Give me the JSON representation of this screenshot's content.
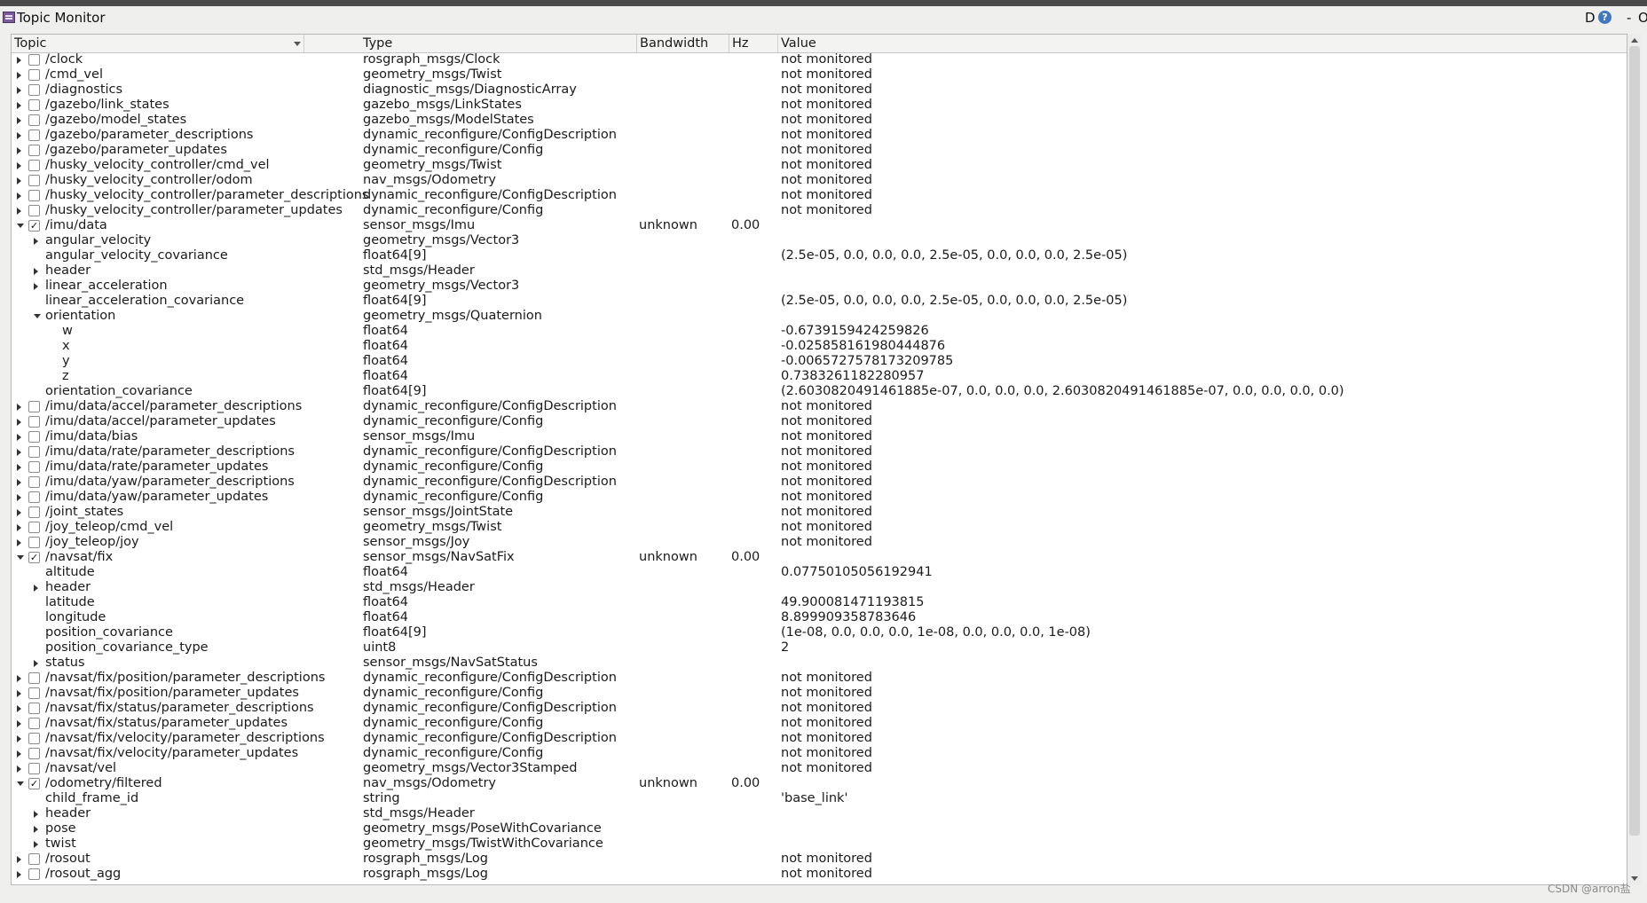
{
  "window": {
    "title": "Topic Monitor",
    "ctrl_d": "D",
    "help": "?",
    "minimize": "-",
    "close": "O"
  },
  "columns": {
    "topic": "Topic",
    "type": "Type",
    "bandwidth": "Bandwidth",
    "hz": "Hz",
    "value": "Value"
  },
  "rows": [
    {
      "level": 0,
      "exp": "c",
      "cb": "u",
      "topic": "/clock",
      "type": "rosgraph_msgs/Clock",
      "bw": "",
      "hz": "",
      "value": "not monitored"
    },
    {
      "level": 0,
      "exp": "c",
      "cb": "u",
      "topic": "/cmd_vel",
      "type": "geometry_msgs/Twist",
      "bw": "",
      "hz": "",
      "value": "not monitored"
    },
    {
      "level": 0,
      "exp": "c",
      "cb": "u",
      "topic": "/diagnostics",
      "type": "diagnostic_msgs/DiagnosticArray",
      "bw": "",
      "hz": "",
      "value": "not monitored"
    },
    {
      "level": 0,
      "exp": "c",
      "cb": "u",
      "topic": "/gazebo/link_states",
      "type": "gazebo_msgs/LinkStates",
      "bw": "",
      "hz": "",
      "value": "not monitored"
    },
    {
      "level": 0,
      "exp": "c",
      "cb": "u",
      "topic": "/gazebo/model_states",
      "type": "gazebo_msgs/ModelStates",
      "bw": "",
      "hz": "",
      "value": "not monitored"
    },
    {
      "level": 0,
      "exp": "c",
      "cb": "u",
      "topic": "/gazebo/parameter_descriptions",
      "type": "dynamic_reconfigure/ConfigDescription",
      "bw": "",
      "hz": "",
      "value": "not monitored"
    },
    {
      "level": 0,
      "exp": "c",
      "cb": "u",
      "topic": "/gazebo/parameter_updates",
      "type": "dynamic_reconfigure/Config",
      "bw": "",
      "hz": "",
      "value": "not monitored"
    },
    {
      "level": 0,
      "exp": "c",
      "cb": "u",
      "topic": "/husky_velocity_controller/cmd_vel",
      "type": "geometry_msgs/Twist",
      "bw": "",
      "hz": "",
      "value": "not monitored"
    },
    {
      "level": 0,
      "exp": "c",
      "cb": "u",
      "topic": "/husky_velocity_controller/odom",
      "type": "nav_msgs/Odometry",
      "bw": "",
      "hz": "",
      "value": "not monitored"
    },
    {
      "level": 0,
      "exp": "c",
      "cb": "u",
      "topic": "/husky_velocity_controller/parameter_descriptions",
      "type": "dynamic_reconfigure/ConfigDescription",
      "bw": "",
      "hz": "",
      "value": "not monitored"
    },
    {
      "level": 0,
      "exp": "c",
      "cb": "u",
      "topic": "/husky_velocity_controller/parameter_updates",
      "type": "dynamic_reconfigure/Config",
      "bw": "",
      "hz": "",
      "value": "not monitored"
    },
    {
      "level": 0,
      "exp": "e",
      "cb": "c",
      "topic": "/imu/data",
      "type": "sensor_msgs/Imu",
      "bw": "unknown",
      "hz": "0.00",
      "value": ""
    },
    {
      "level": 1,
      "exp": "c",
      "cb": "n",
      "topic": "angular_velocity",
      "type": "geometry_msgs/Vector3",
      "bw": "",
      "hz": "",
      "value": ""
    },
    {
      "level": 1,
      "exp": "n",
      "cb": "n",
      "topic": "angular_velocity_covariance",
      "type": "float64[9]",
      "bw": "",
      "hz": "",
      "value": "(2.5e-05, 0.0, 0.0, 0.0, 2.5e-05, 0.0, 0.0, 0.0, 2.5e-05)"
    },
    {
      "level": 1,
      "exp": "c",
      "cb": "n",
      "topic": "header",
      "type": "std_msgs/Header",
      "bw": "",
      "hz": "",
      "value": ""
    },
    {
      "level": 1,
      "exp": "c",
      "cb": "n",
      "topic": "linear_acceleration",
      "type": "geometry_msgs/Vector3",
      "bw": "",
      "hz": "",
      "value": ""
    },
    {
      "level": 1,
      "exp": "n",
      "cb": "n",
      "topic": "linear_acceleration_covariance",
      "type": "float64[9]",
      "bw": "",
      "hz": "",
      "value": "(2.5e-05, 0.0, 0.0, 0.0, 2.5e-05, 0.0, 0.0, 0.0, 2.5e-05)"
    },
    {
      "level": 1,
      "exp": "e",
      "cb": "n",
      "topic": "orientation",
      "type": "geometry_msgs/Quaternion",
      "bw": "",
      "hz": "",
      "value": ""
    },
    {
      "level": 2,
      "exp": "n",
      "cb": "n",
      "topic": "w",
      "type": "float64",
      "bw": "",
      "hz": "",
      "value": "-0.6739159424259826"
    },
    {
      "level": 2,
      "exp": "n",
      "cb": "n",
      "topic": "x",
      "type": "float64",
      "bw": "",
      "hz": "",
      "value": "-0.025858161980444876"
    },
    {
      "level": 2,
      "exp": "n",
      "cb": "n",
      "topic": "y",
      "type": "float64",
      "bw": "",
      "hz": "",
      "value": "-0.0065727578173209785"
    },
    {
      "level": 2,
      "exp": "n",
      "cb": "n",
      "topic": "z",
      "type": "float64",
      "bw": "",
      "hz": "",
      "value": "0.7383261182280957"
    },
    {
      "level": 1,
      "exp": "n",
      "cb": "n",
      "topic": "orientation_covariance",
      "type": "float64[9]",
      "bw": "",
      "hz": "",
      "value": "(2.6030820491461885e-07, 0.0, 0.0, 0.0, 2.6030820491461885e-07, 0.0, 0.0, 0.0, 0.0)"
    },
    {
      "level": 0,
      "exp": "c",
      "cb": "u",
      "topic": "/imu/data/accel/parameter_descriptions",
      "type": "dynamic_reconfigure/ConfigDescription",
      "bw": "",
      "hz": "",
      "value": "not monitored"
    },
    {
      "level": 0,
      "exp": "c",
      "cb": "u",
      "topic": "/imu/data/accel/parameter_updates",
      "type": "dynamic_reconfigure/Config",
      "bw": "",
      "hz": "",
      "value": "not monitored"
    },
    {
      "level": 0,
      "exp": "c",
      "cb": "u",
      "topic": "/imu/data/bias",
      "type": "sensor_msgs/Imu",
      "bw": "",
      "hz": "",
      "value": "not monitored"
    },
    {
      "level": 0,
      "exp": "c",
      "cb": "u",
      "topic": "/imu/data/rate/parameter_descriptions",
      "type": "dynamic_reconfigure/ConfigDescription",
      "bw": "",
      "hz": "",
      "value": "not monitored"
    },
    {
      "level": 0,
      "exp": "c",
      "cb": "u",
      "topic": "/imu/data/rate/parameter_updates",
      "type": "dynamic_reconfigure/Config",
      "bw": "",
      "hz": "",
      "value": "not monitored"
    },
    {
      "level": 0,
      "exp": "c",
      "cb": "u",
      "topic": "/imu/data/yaw/parameter_descriptions",
      "type": "dynamic_reconfigure/ConfigDescription",
      "bw": "",
      "hz": "",
      "value": "not monitored"
    },
    {
      "level": 0,
      "exp": "c",
      "cb": "u",
      "topic": "/imu/data/yaw/parameter_updates",
      "type": "dynamic_reconfigure/Config",
      "bw": "",
      "hz": "",
      "value": "not monitored"
    },
    {
      "level": 0,
      "exp": "c",
      "cb": "u",
      "topic": "/joint_states",
      "type": "sensor_msgs/JointState",
      "bw": "",
      "hz": "",
      "value": "not monitored"
    },
    {
      "level": 0,
      "exp": "c",
      "cb": "u",
      "topic": "/joy_teleop/cmd_vel",
      "type": "geometry_msgs/Twist",
      "bw": "",
      "hz": "",
      "value": "not monitored"
    },
    {
      "level": 0,
      "exp": "c",
      "cb": "u",
      "topic": "/joy_teleop/joy",
      "type": "sensor_msgs/Joy",
      "bw": "",
      "hz": "",
      "value": "not monitored"
    },
    {
      "level": 0,
      "exp": "e",
      "cb": "c",
      "topic": "/navsat/fix",
      "type": "sensor_msgs/NavSatFix",
      "bw": "unknown",
      "hz": "0.00",
      "value": ""
    },
    {
      "level": 1,
      "exp": "n",
      "cb": "n",
      "topic": "altitude",
      "type": "float64",
      "bw": "",
      "hz": "",
      "value": "0.07750105056192941"
    },
    {
      "level": 1,
      "exp": "c",
      "cb": "n",
      "topic": "header",
      "type": "std_msgs/Header",
      "bw": "",
      "hz": "",
      "value": ""
    },
    {
      "level": 1,
      "exp": "n",
      "cb": "n",
      "topic": "latitude",
      "type": "float64",
      "bw": "",
      "hz": "",
      "value": "49.900081471193815"
    },
    {
      "level": 1,
      "exp": "n",
      "cb": "n",
      "topic": "longitude",
      "type": "float64",
      "bw": "",
      "hz": "",
      "value": "8.899909358783646"
    },
    {
      "level": 1,
      "exp": "n",
      "cb": "n",
      "topic": "position_covariance",
      "type": "float64[9]",
      "bw": "",
      "hz": "",
      "value": "(1e-08, 0.0, 0.0, 0.0, 1e-08, 0.0, 0.0, 0.0, 1e-08)"
    },
    {
      "level": 1,
      "exp": "n",
      "cb": "n",
      "topic": "position_covariance_type",
      "type": "uint8",
      "bw": "",
      "hz": "",
      "value": "2"
    },
    {
      "level": 1,
      "exp": "c",
      "cb": "n",
      "topic": "status",
      "type": "sensor_msgs/NavSatStatus",
      "bw": "",
      "hz": "",
      "value": ""
    },
    {
      "level": 0,
      "exp": "c",
      "cb": "u",
      "topic": "/navsat/fix/position/parameter_descriptions",
      "type": "dynamic_reconfigure/ConfigDescription",
      "bw": "",
      "hz": "",
      "value": "not monitored"
    },
    {
      "level": 0,
      "exp": "c",
      "cb": "u",
      "topic": "/navsat/fix/position/parameter_updates",
      "type": "dynamic_reconfigure/Config",
      "bw": "",
      "hz": "",
      "value": "not monitored"
    },
    {
      "level": 0,
      "exp": "c",
      "cb": "u",
      "topic": "/navsat/fix/status/parameter_descriptions",
      "type": "dynamic_reconfigure/ConfigDescription",
      "bw": "",
      "hz": "",
      "value": "not monitored"
    },
    {
      "level": 0,
      "exp": "c",
      "cb": "u",
      "topic": "/navsat/fix/status/parameter_updates",
      "type": "dynamic_reconfigure/Config",
      "bw": "",
      "hz": "",
      "value": "not monitored"
    },
    {
      "level": 0,
      "exp": "c",
      "cb": "u",
      "topic": "/navsat/fix/velocity/parameter_descriptions",
      "type": "dynamic_reconfigure/ConfigDescription",
      "bw": "",
      "hz": "",
      "value": "not monitored"
    },
    {
      "level": 0,
      "exp": "c",
      "cb": "u",
      "topic": "/navsat/fix/velocity/parameter_updates",
      "type": "dynamic_reconfigure/Config",
      "bw": "",
      "hz": "",
      "value": "not monitored"
    },
    {
      "level": 0,
      "exp": "c",
      "cb": "u",
      "topic": "/navsat/vel",
      "type": "geometry_msgs/Vector3Stamped",
      "bw": "",
      "hz": "",
      "value": "not monitored"
    },
    {
      "level": 0,
      "exp": "e",
      "cb": "c",
      "topic": "/odometry/filtered",
      "type": "nav_msgs/Odometry",
      "bw": "unknown",
      "hz": "0.00",
      "value": ""
    },
    {
      "level": 1,
      "exp": "n",
      "cb": "n",
      "topic": "child_frame_id",
      "type": "string",
      "bw": "",
      "hz": "",
      "value": "'base_link'"
    },
    {
      "level": 1,
      "exp": "c",
      "cb": "n",
      "topic": "header",
      "type": "std_msgs/Header",
      "bw": "",
      "hz": "",
      "value": ""
    },
    {
      "level": 1,
      "exp": "c",
      "cb": "n",
      "topic": "pose",
      "type": "geometry_msgs/PoseWithCovariance",
      "bw": "",
      "hz": "",
      "value": ""
    },
    {
      "level": 1,
      "exp": "c",
      "cb": "n",
      "topic": "twist",
      "type": "geometry_msgs/TwistWithCovariance",
      "bw": "",
      "hz": "",
      "value": ""
    },
    {
      "level": 0,
      "exp": "c",
      "cb": "u",
      "topic": "/rosout",
      "type": "rosgraph_msgs/Log",
      "bw": "",
      "hz": "",
      "value": "not monitored"
    },
    {
      "level": 0,
      "exp": "c",
      "cb": "u",
      "topic": "/rosout_agg",
      "type": "rosgraph_msgs/Log",
      "bw": "",
      "hz": "",
      "value": "not monitored"
    }
  ],
  "watermark": "CSDN @arron盐"
}
